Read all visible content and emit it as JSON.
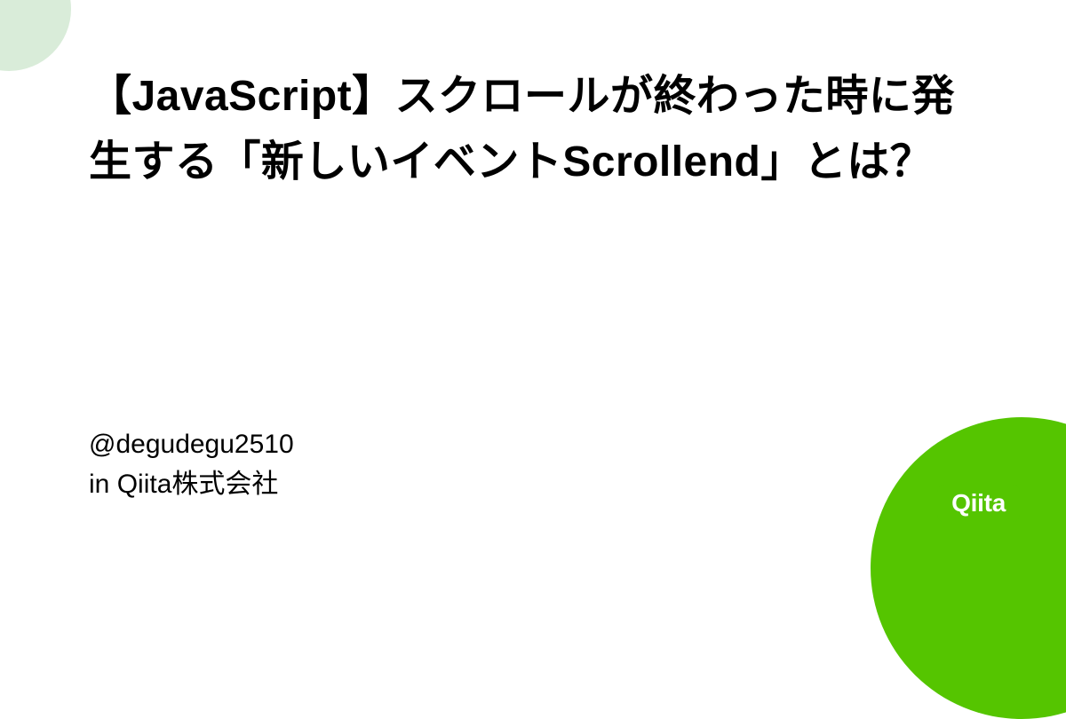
{
  "article": {
    "title": "【JavaScript】スクロールが終わった時に発生する「新しいイベントScrollend」とは？"
  },
  "author": {
    "handle": "@degudegu2510",
    "organization_prefix": "in ",
    "organization": "Qiita株式会社"
  },
  "brand": {
    "name": "Qiita",
    "accent_color": "#55c500",
    "light_accent": "#d9ecd9"
  }
}
